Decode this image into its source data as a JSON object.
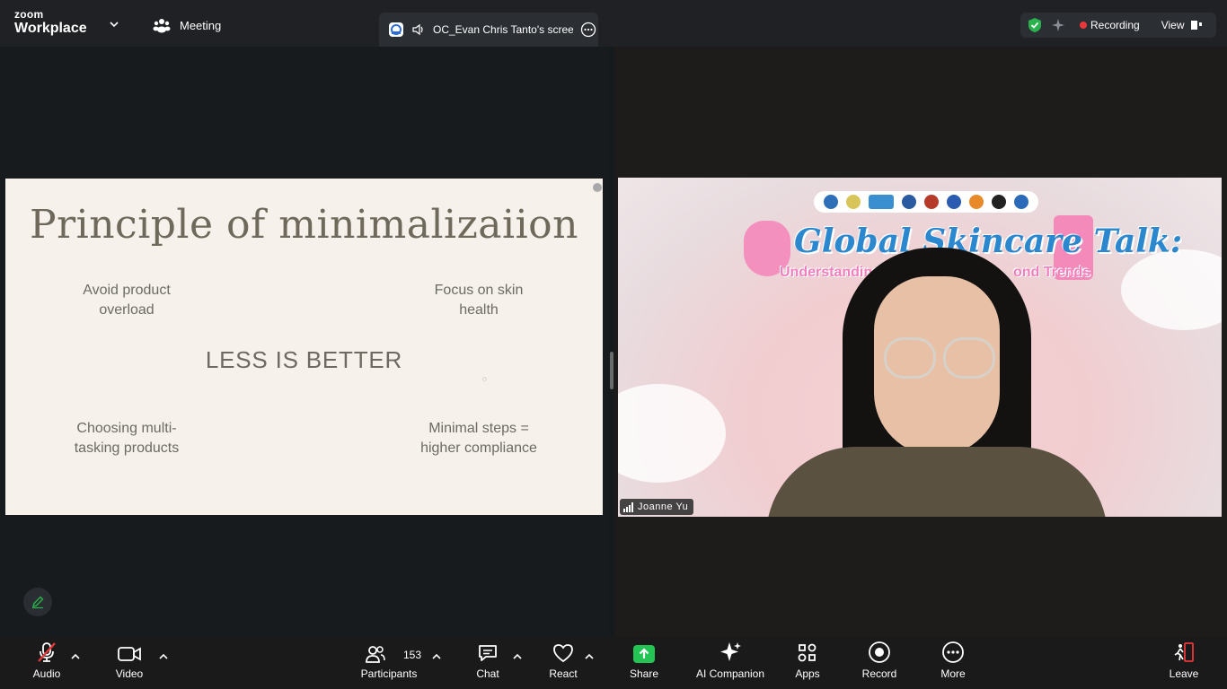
{
  "app": {
    "logo_top": "zoom",
    "logo_bottom": "Workplace"
  },
  "topbar": {
    "meeting_label": "Meeting",
    "share_tab_title": "OC_Evan Chris Tanto's screen",
    "recording_label": "Recording",
    "view_label": "View"
  },
  "slide": {
    "title": "Principle of minimalizaiion",
    "items": [
      {
        "line1": "Avoid  product",
        "line2": "overload"
      },
      {
        "line1": "Focus on skin",
        "line2": "health"
      },
      {
        "line1": "Choosing multi-",
        "line2": "tasking products"
      },
      {
        "line1": "Minimal steps =",
        "line2": "higher compliance"
      }
    ],
    "center_text": "LESS IS BETTER"
  },
  "video": {
    "participant_name": "Joanne Yu",
    "banner_title": "Global Skincare Talk:",
    "banner_subtitle_left": "Understanding",
    "banner_subtitle_right": "ond Trends"
  },
  "toolbar": {
    "audio": "Audio",
    "video": "Video",
    "participants": "Participants",
    "participants_count": "153",
    "chat": "Chat",
    "react": "React",
    "share": "Share",
    "ai_companion": "AI Companion",
    "apps": "Apps",
    "record": "Record",
    "more": "More",
    "leave": "Leave"
  },
  "colors": {
    "share_green": "#23c454",
    "recording_red": "#e8383a",
    "leave_red": "#e8383a",
    "shield_green": "#2bb24c",
    "slide_bg": "#f6f1ea"
  }
}
